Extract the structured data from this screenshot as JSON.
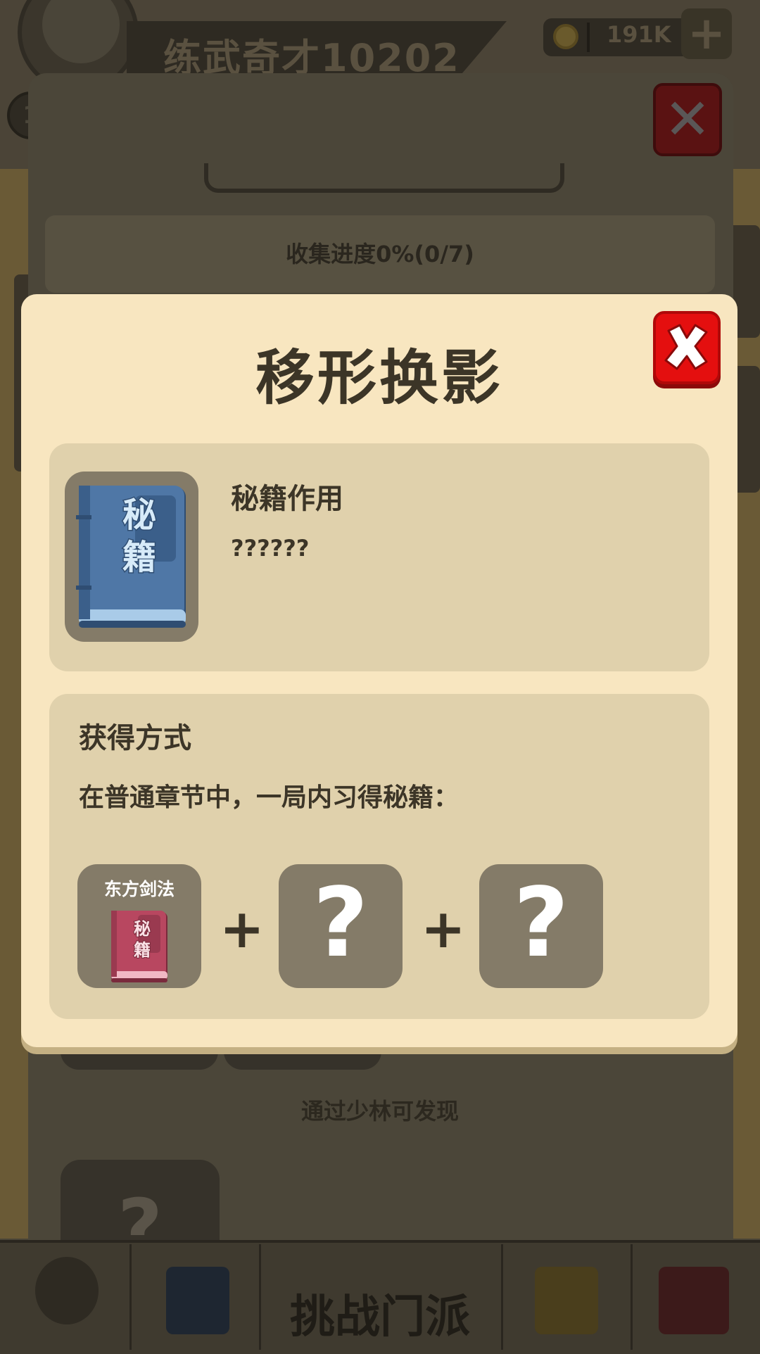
{
  "player": {
    "name": "练武奇才10202",
    "coins": "191K",
    "coin_plus": "+",
    "level_badge": "1"
  },
  "collection": {
    "progress": "收集进度0%(0/7)",
    "hint": "通过少林可发现",
    "card_placeholder": "?"
  },
  "bottom_nav": {
    "challenge_label": "挑战门派"
  },
  "dialog": {
    "title": "移形换影",
    "effect_label": "秘籍作用",
    "effect_value": "??????",
    "book_text": [
      "秘",
      "籍"
    ],
    "obtain_label": "获得方式",
    "obtain_desc": "在普通章节中，一局内习得秘籍：",
    "requirements": [
      {
        "name": "东方剑法",
        "known": true,
        "book_text": [
          "秘",
          "籍"
        ]
      },
      {
        "name": "?",
        "known": false
      },
      {
        "name": "?",
        "known": false
      }
    ],
    "plus_symbol": "+"
  },
  "colors": {
    "dialog_bg": "#f8e6c0",
    "card_bg": "#e0d1ac",
    "slot_bg": "#847b68",
    "close_red": "#e40f0f",
    "book_blue": "#4f77a6",
    "book_red": "#b84760",
    "text_dark": "#3c3527"
  },
  "icons": {
    "close": "close-x-icon",
    "secret_book": "secret-book-icon",
    "coin": "coin-icon"
  }
}
